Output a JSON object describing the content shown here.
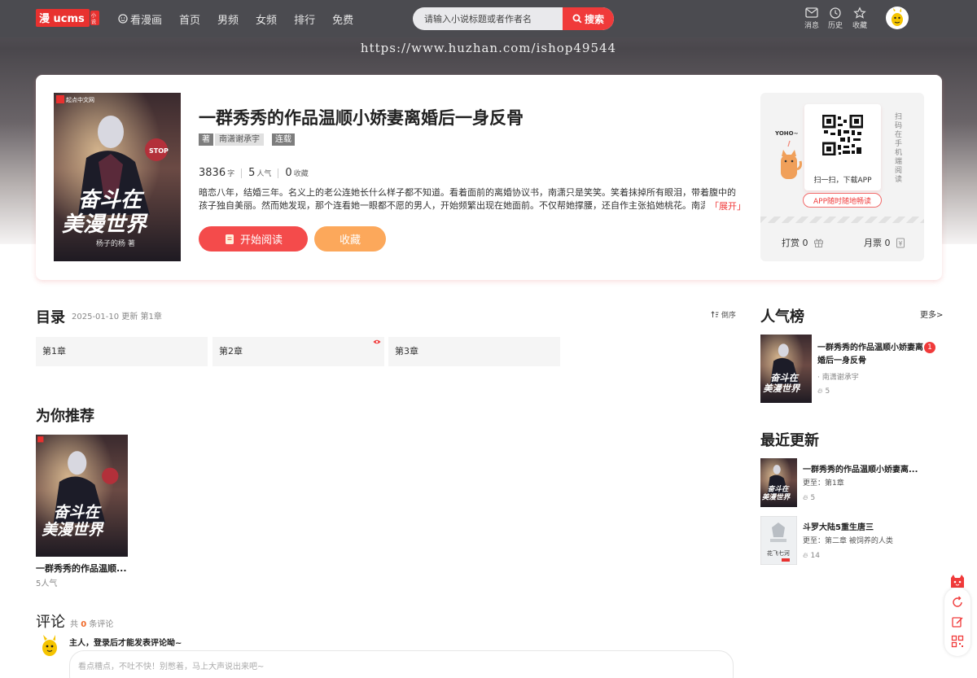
{
  "header": {
    "logo_text": "漫画小说",
    "nav": [
      {
        "label": "看漫画",
        "icon": "smile-icon"
      },
      {
        "label": "首页"
      },
      {
        "label": "男频"
      },
      {
        "label": "女频"
      },
      {
        "label": "排行"
      },
      {
        "label": "免费"
      }
    ],
    "search_placeholder": "请输入小说标题或者作者名",
    "search_button": "搜索",
    "icons": [
      {
        "label": "消息",
        "icon": "message-icon"
      },
      {
        "label": "历史",
        "icon": "clock-icon"
      },
      {
        "label": "收藏",
        "icon": "star-icon"
      }
    ]
  },
  "watermark": "https://www.huzhan.com/ishop49544",
  "book": {
    "title": "一群秀秀的作品温顺小娇妻离婚后一身反骨",
    "author_tag": "著",
    "author": "南潇谢承宇",
    "status": "连载",
    "words": "3836",
    "words_unit": "字",
    "popularity": "5",
    "popularity_unit": "人气",
    "favorites": "0",
    "favorites_unit": "收藏",
    "intro": "暗恋八年，结婚三年。名义上的老公连她长什么样子都不知道。看着面前的离婚协议书，南潇只是笑笑。笑着抹掉所有眼泪，带着腹中的孩子独自美丽。然而她发现，那个连看她一眼都不愿的男人，开始频繁出现在她面前。不仅帮她撑腰，还自作主张掐她桃花。南潇忍无可忍：",
    "expand": "「展开」",
    "read_button": "开始阅读",
    "fav_button": "收藏",
    "cover_text_1": "奋斗在",
    "cover_text_2": "美漫世界",
    "cover_author": "杨子的杨 著",
    "cover_publisher": "起点中文网"
  },
  "app": {
    "scan_label": "扫一扫，下载APP",
    "side_text": "扫码在手机端阅读",
    "button": "APP随时随地畅读",
    "mascot_text": "YOHO~",
    "tip_label": "打赏",
    "tip_count": "0",
    "ticket_label": "月票",
    "ticket_count": "0"
  },
  "toc": {
    "title": "目录",
    "meta": "2025-01-10 更新 第1章",
    "sort": "倒序",
    "chapters": [
      "第1章",
      "第2章",
      "第3章"
    ]
  },
  "recommend": {
    "title": "为你推荐",
    "items": [
      {
        "title": "一群秀秀的作品温顺...",
        "pop": "5人气"
      }
    ]
  },
  "comments": {
    "title": "评论",
    "prefix": "共",
    "count": "0",
    "suffix": "条评论",
    "login_tip": "主人，登录后才能发表评论呦~",
    "placeholder": "看点糟点，不吐不快！别憋着，马上大声说出来吧~"
  },
  "popular": {
    "title": "人气榜",
    "more": "更多>",
    "items": [
      {
        "title": "一群秀秀的作品温顺小娇妻离婚后一身反骨",
        "author": "· 南潇谢承宇",
        "hot": "5",
        "rank": "1"
      }
    ]
  },
  "recent": {
    "title": "最近更新",
    "items": [
      {
        "title": "一群秀秀的作品温顺小娇妻离...",
        "sub": "更至：第1章",
        "hot": "5"
      },
      {
        "title": "斗罗大陆5重生唐三",
        "sub": "更至：第二章 被饲养的人类",
        "hot": "14",
        "cover_text": "花飞七河"
      }
    ]
  },
  "colors": {
    "accent": "#f03a3a",
    "orange": "#fca85b",
    "header": "#4b4b50"
  }
}
